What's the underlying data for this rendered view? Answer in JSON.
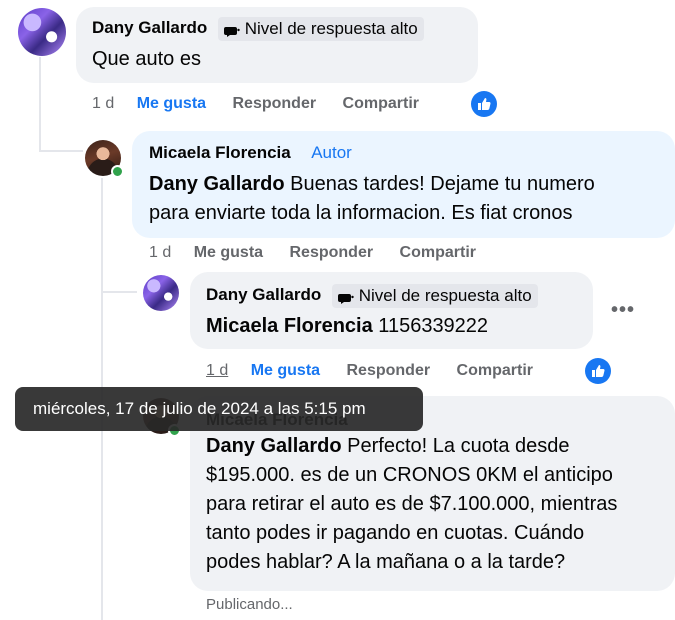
{
  "comments": [
    {
      "author": "Dany Gallardo",
      "badge": "Nivel de respuesta alto",
      "text": "Que auto es",
      "time": "1 d",
      "like": "Me gusta",
      "reply": "Responder",
      "share": "Compartir"
    },
    {
      "author": "Micaela Florencia",
      "author_tag": "Autor",
      "mention": "Dany Gallardo",
      "text_line1": " Buenas tardes! Dejame tu numero",
      "text_line2": "para enviarte toda la informacion. Es fiat cronos",
      "time": "1 d",
      "like": "Me gusta",
      "reply": "Responder",
      "share": "Compartir"
    },
    {
      "author": "Dany Gallardo",
      "badge": "Nivel de respuesta alto",
      "mention": "Micaela Florencia",
      "text": " 1156339222",
      "time": "1 d",
      "like": "Me gusta",
      "reply": "Responder",
      "share": "Compartir",
      "more": "•••"
    },
    {
      "author": "Micaela Florencia",
      "mention": "Dany Gallardo",
      "line1": " Perfecto! La cuota desde",
      "line2": "$195.000. es de un CRONOS 0KM el anticipo",
      "line3": "para retirar el auto es de $7.100.000, mientras",
      "line4": "tanto podes ir pagando en cuotas. Cuándo",
      "line5": "podes hablar? A la mañana o a la tarde?",
      "status": "Publicando..."
    }
  ],
  "tooltip": "miércoles, 17 de julio de 2024 a las 5:15 pm",
  "colors": {
    "accent": "#1877f2",
    "bubble": "#f0f2f5",
    "author_bubble": "#ebf5ff",
    "online": "#31a24c"
  }
}
